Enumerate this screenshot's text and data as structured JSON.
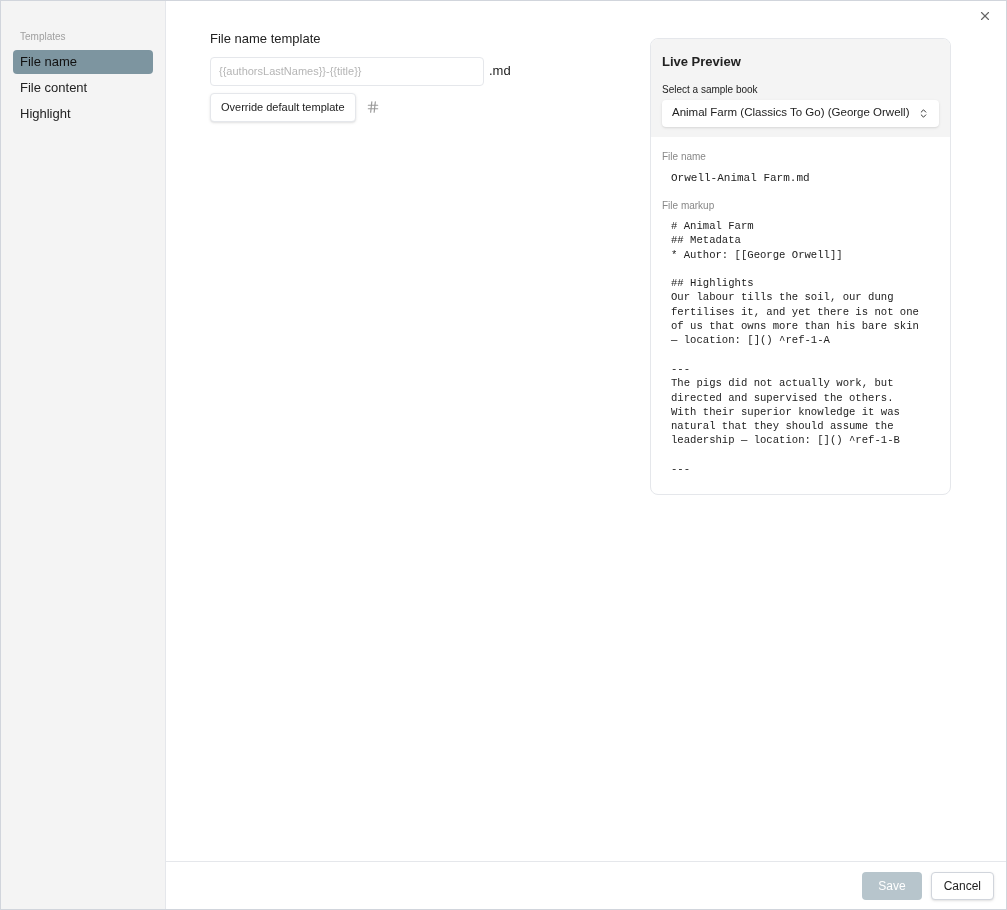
{
  "sidebar": {
    "heading": "Templates",
    "items": [
      {
        "label": "File name",
        "selected": true
      },
      {
        "label": "File content",
        "selected": false
      },
      {
        "label": "Highlight",
        "selected": false
      }
    ]
  },
  "form": {
    "title": "File name template",
    "template_field": {
      "placeholder": "{{authorsLastNames}}-{{title}}"
    },
    "extension": ".md",
    "override_button": "Override default template"
  },
  "preview": {
    "title": "Live Preview",
    "select_label": "Select a sample book",
    "select_value": "Animal Farm (Classics To Go) (George Orwell)",
    "file_name_label": "File name",
    "file_name": "Orwell-Animal Farm.md",
    "file_markup_label": "File markup",
    "file_markup": "# Animal Farm\n## Metadata\n* Author: [[George Orwell]]\n\n## Highlights\nOur labour tills the soil, our dung\nfertilises it, and yet there is not one\nof us that owns more than his bare skin\n— location: []() ^ref-1-A\n\n---\nThe pigs did not actually work, but\ndirected and supervised the others.\nWith their superior knowledge it was\nnatural that they should assume the\nleadership — location: []() ^ref-1-B\n\n---"
  },
  "footer": {
    "save": {
      "label": "Save",
      "disabled": true
    },
    "cancel": {
      "label": "Cancel",
      "disabled": false
    }
  }
}
